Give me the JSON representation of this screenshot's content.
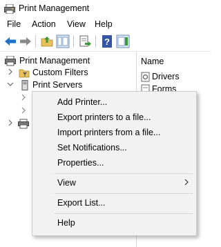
{
  "window": {
    "title": "Print Management"
  },
  "menu": [
    "File",
    "Action",
    "View",
    "Help"
  ],
  "toolbar": {
    "buttons": [
      "back-icon",
      "forward-icon",
      "up-folder-icon",
      "show-hide-tree-icon",
      "export-list-icon",
      "help-icon",
      "action-pane-icon"
    ]
  },
  "tree": {
    "root": "Print Management",
    "custom_filters": "Custom Filters",
    "print_servers": "Print Servers"
  },
  "list": {
    "header": "Name",
    "items": [
      "Drivers",
      "Forms"
    ]
  },
  "context_menu": {
    "add_printer": "Add Printer...",
    "export_printers": "Export printers to a file...",
    "import_printers": "Import printers from a file...",
    "set_notifications": "Set Notifications...",
    "properties": "Properties...",
    "view": "View",
    "export_list": "Export List...",
    "help": "Help"
  },
  "colors": {
    "menu_background": "#f2f2f2",
    "menu_border": "#cccccc",
    "arrow_blue": "#1e72c8",
    "help_blue": "#3455a4",
    "folder_yellow": "#e8c15a"
  }
}
